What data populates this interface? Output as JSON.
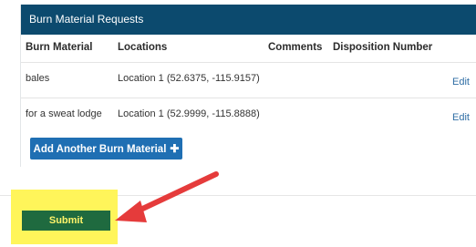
{
  "panel": {
    "title": "Burn Material Requests",
    "columns": [
      "Burn Material",
      "Locations",
      "Comments",
      "Disposition Number"
    ],
    "rows": [
      {
        "material": "bales",
        "location": "Location 1 (52.6375, -115.9157)",
        "edit": "Edit"
      },
      {
        "material": "for a sweat lodge",
        "location": "Location 1 (52.9999, -115.8888)",
        "edit": "Edit"
      }
    ],
    "add_button": "Add Another Burn Material"
  },
  "submit_label": "Submit",
  "colors": {
    "header_bg": "#0c4a6e",
    "add_bg": "#1f6fb3",
    "submit_bg": "#1f6a3f",
    "highlight": "#fff55a",
    "arrow": "#e53b3b"
  }
}
